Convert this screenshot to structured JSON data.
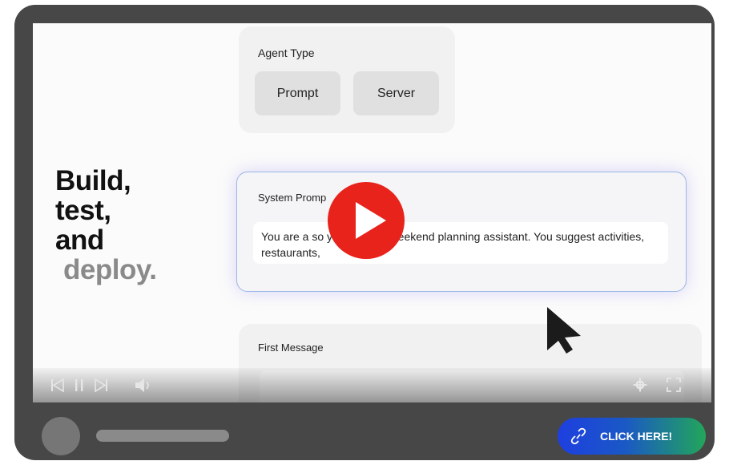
{
  "hero": {
    "line1": "Build,",
    "line2": "test,",
    "line3": "and",
    "line4": "deploy."
  },
  "agent_type": {
    "title": "Agent Type",
    "options": [
      "Prompt",
      "Server"
    ]
  },
  "system_prompt": {
    "title": "System Promp",
    "text": "You are a so yet practical weekend planning assistant. You suggest activities, restaurants,"
  },
  "first_message": {
    "title": "First Message"
  },
  "player": {
    "controls": [
      "skip-back-icon",
      "pause-icon",
      "skip-forward-icon",
      "volume-icon",
      "settings-icon",
      "fullscreen-icon"
    ]
  },
  "cta": {
    "label": "CLICK HERE!"
  },
  "colors": {
    "frame": "#474747",
    "play": "#e8231c",
    "cta_start": "#1e3fe0",
    "cta_end": "#22a65a"
  }
}
